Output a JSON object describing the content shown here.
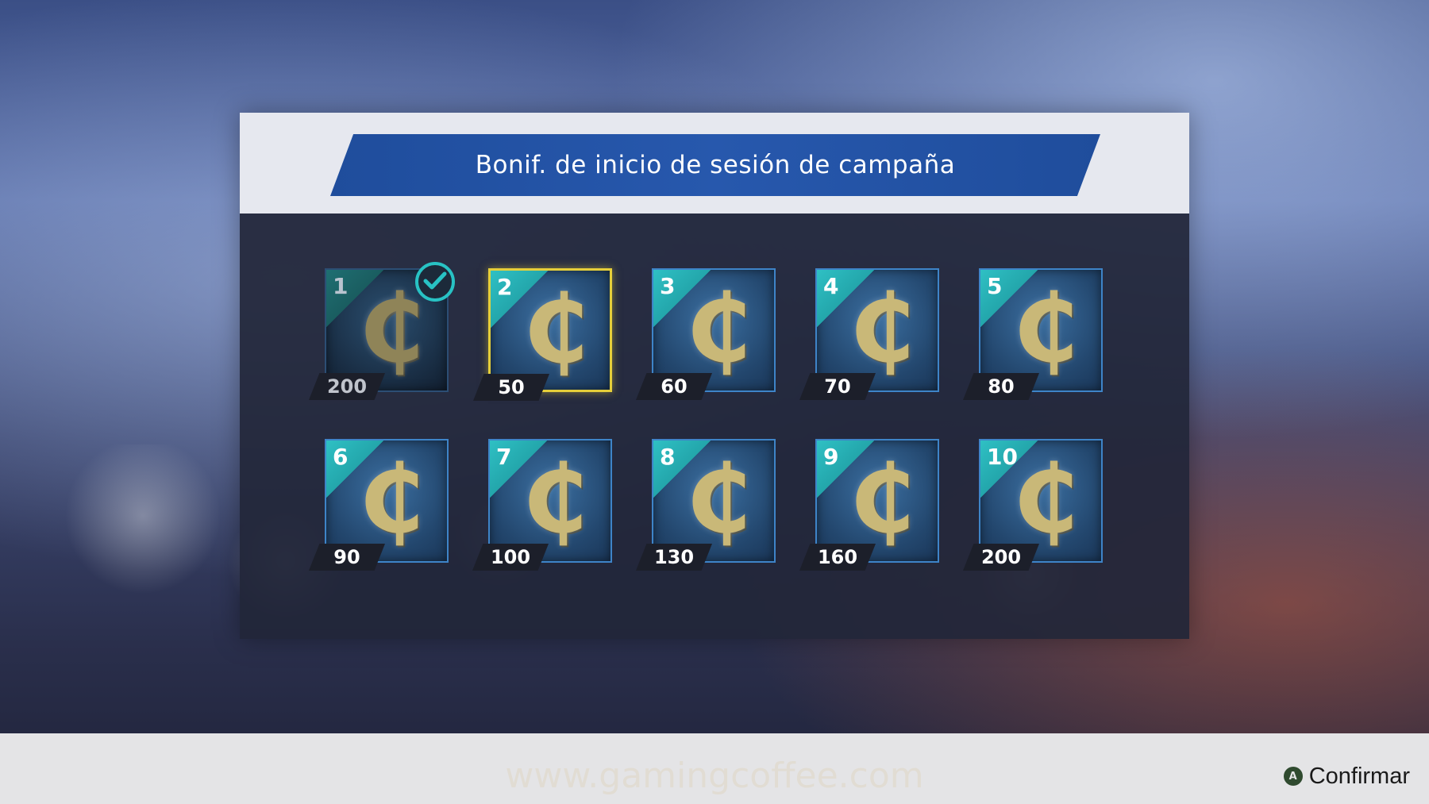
{
  "title": "Bonif. de inicio de sesión de campaña",
  "currency_icon": "coin-icon",
  "days": [
    {
      "day": "1",
      "amount": "200",
      "claimed": true
    },
    {
      "day": "2",
      "amount": "50",
      "selected": true
    },
    {
      "day": "3",
      "amount": "60"
    },
    {
      "day": "4",
      "amount": "70"
    },
    {
      "day": "5",
      "amount": "80"
    },
    {
      "day": "6",
      "amount": "90"
    },
    {
      "day": "7",
      "amount": "100"
    },
    {
      "day": "8",
      "amount": "130"
    },
    {
      "day": "9",
      "amount": "160"
    },
    {
      "day": "10",
      "amount": "200"
    }
  ],
  "coin_glyph": "₵",
  "footer": {
    "button_glyph": "A",
    "confirm_label": "Confirmar"
  },
  "watermark": "www.gamingcoffee.com",
  "colors": {
    "title_banner": "#2758ad",
    "selected_border": "#e6cf3a",
    "claimed_check": "#28c2c4"
  }
}
